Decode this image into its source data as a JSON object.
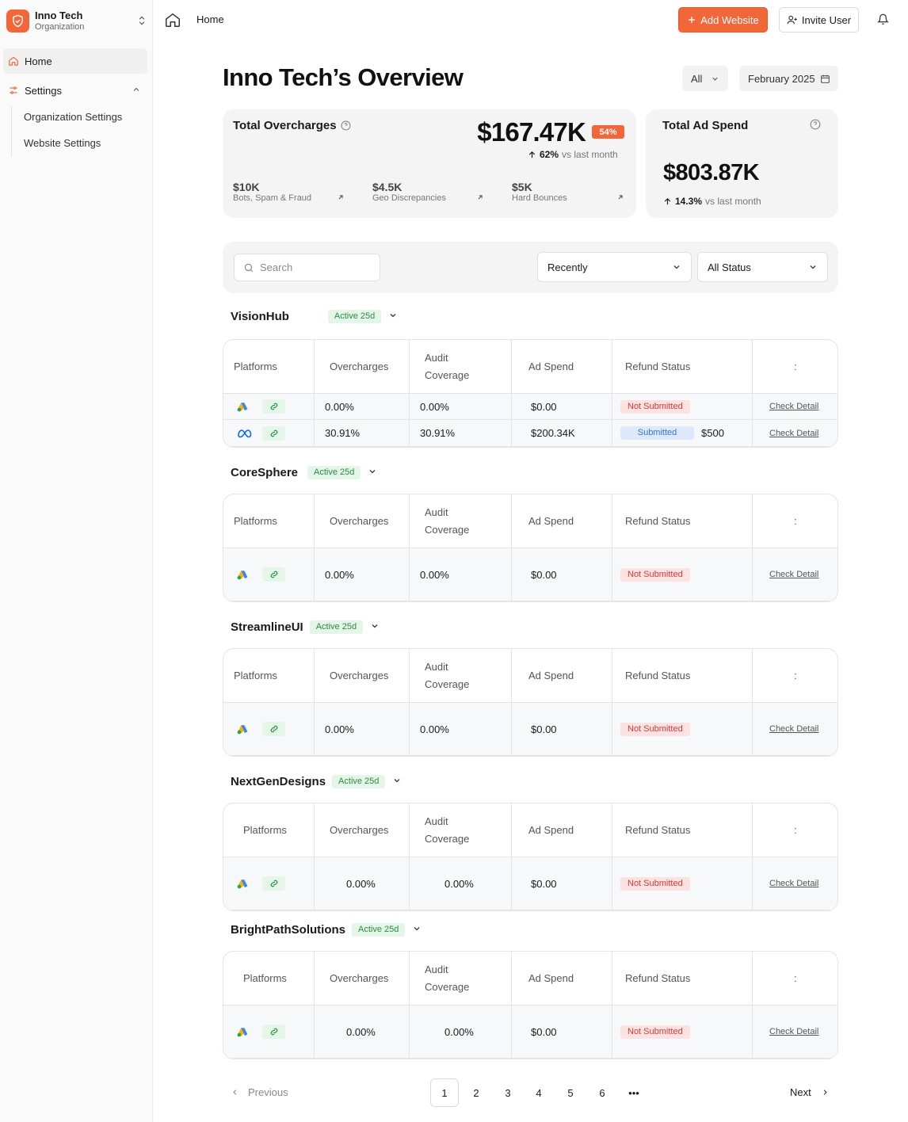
{
  "sidebar": {
    "org_name": "Inno Tech",
    "org_type": "Organization",
    "nav_home": "Home",
    "nav_settings": "Settings",
    "sub_items": [
      "Organization Settings",
      "Website Settings"
    ]
  },
  "topbar": {
    "breadcrumb": "Home",
    "add_website": "Add Website",
    "invite_user": "Invite User"
  },
  "page": {
    "title": "Inno Tech’s Overview",
    "filter_all": "All",
    "filter_date": "February 2025"
  },
  "overcharges": {
    "title": "Total Overcharges",
    "value": "$167.47K",
    "badge": "54%",
    "trend_pct": "62%",
    "trend_text": "vs last month",
    "metrics": [
      {
        "value": "$10K",
        "label": "Bots, Spam & Fraud"
      },
      {
        "value": "$4.5K",
        "label": "Geo Discrepancies"
      },
      {
        "value": "$5K",
        "label": "Hard Bounces"
      }
    ]
  },
  "adspend": {
    "title": "Total Ad Spend",
    "value": "$803.87K",
    "trend_pct": "14.3%",
    "trend_text": "vs last month"
  },
  "filters": {
    "search_placeholder": "Search",
    "sort": "Recently",
    "status": "All Status"
  },
  "table_headers": {
    "platforms": "Platforms",
    "overcharges": "Overcharges",
    "audit1": "Audit",
    "audit2": "Coverage",
    "ad_spend": "Ad Spend",
    "refund": "Refund Status",
    "actions": ":"
  },
  "groups": [
    {
      "name": "VisionHub",
      "badge": "Active 25d",
      "rows": [
        {
          "platform": "google-ads",
          "overcharges": "0.00%",
          "audit": "0.00%",
          "ad_spend": "$0.00",
          "status": "Not Submitted",
          "refund": "",
          "detail": "Check Detail"
        },
        {
          "platform": "meta",
          "overcharges": "30.91%",
          "audit": "30.91%",
          "ad_spend": "$200.34K",
          "status": "Submitted",
          "refund": "$500",
          "detail": "Check Detail"
        }
      ]
    },
    {
      "name": "CoreSphere",
      "badge": "Active 25d",
      "rows": [
        {
          "platform": "google-ads",
          "overcharges": "0.00%",
          "audit": "0.00%",
          "ad_spend": "$0.00",
          "status": "Not Submitted",
          "refund": "",
          "detail": "Check Detail"
        }
      ]
    },
    {
      "name": "StreamlineUI",
      "badge": "Active 25d",
      "rows": [
        {
          "platform": "google-ads",
          "overcharges": "0.00%",
          "audit": "0.00%",
          "ad_spend": "$0.00",
          "status": "Not Submitted",
          "refund": "",
          "detail": "Check Detail"
        }
      ]
    },
    {
      "name": "NextGenDesigns",
      "badge": "Active 25d",
      "rows": [
        {
          "platform": "google-ads",
          "overcharges": "0.00%",
          "audit": "0.00%",
          "ad_spend": "$0.00",
          "status": "Not Submitted",
          "refund": "",
          "detail": "Check Detail"
        }
      ]
    },
    {
      "name": "BrightPathSolutions",
      "badge": "Active 25d",
      "rows": [
        {
          "platform": "google-ads",
          "overcharges": "0.00%",
          "audit": "0.00%",
          "ad_spend": "$0.00",
          "status": "Not Submitted",
          "refund": "",
          "detail": "Check Detail"
        }
      ]
    }
  ],
  "pagination": {
    "previous": "Previous",
    "next": "Next",
    "pages": [
      "1",
      "2",
      "3",
      "4",
      "5",
      "6",
      "•••"
    ],
    "current": "1"
  },
  "colors": {
    "accent": "#f2673a",
    "active_badge_bg": "#e3f6e7",
    "not_submitted_bg": "#fde2e2",
    "submitted_bg": "#dde9fb"
  }
}
